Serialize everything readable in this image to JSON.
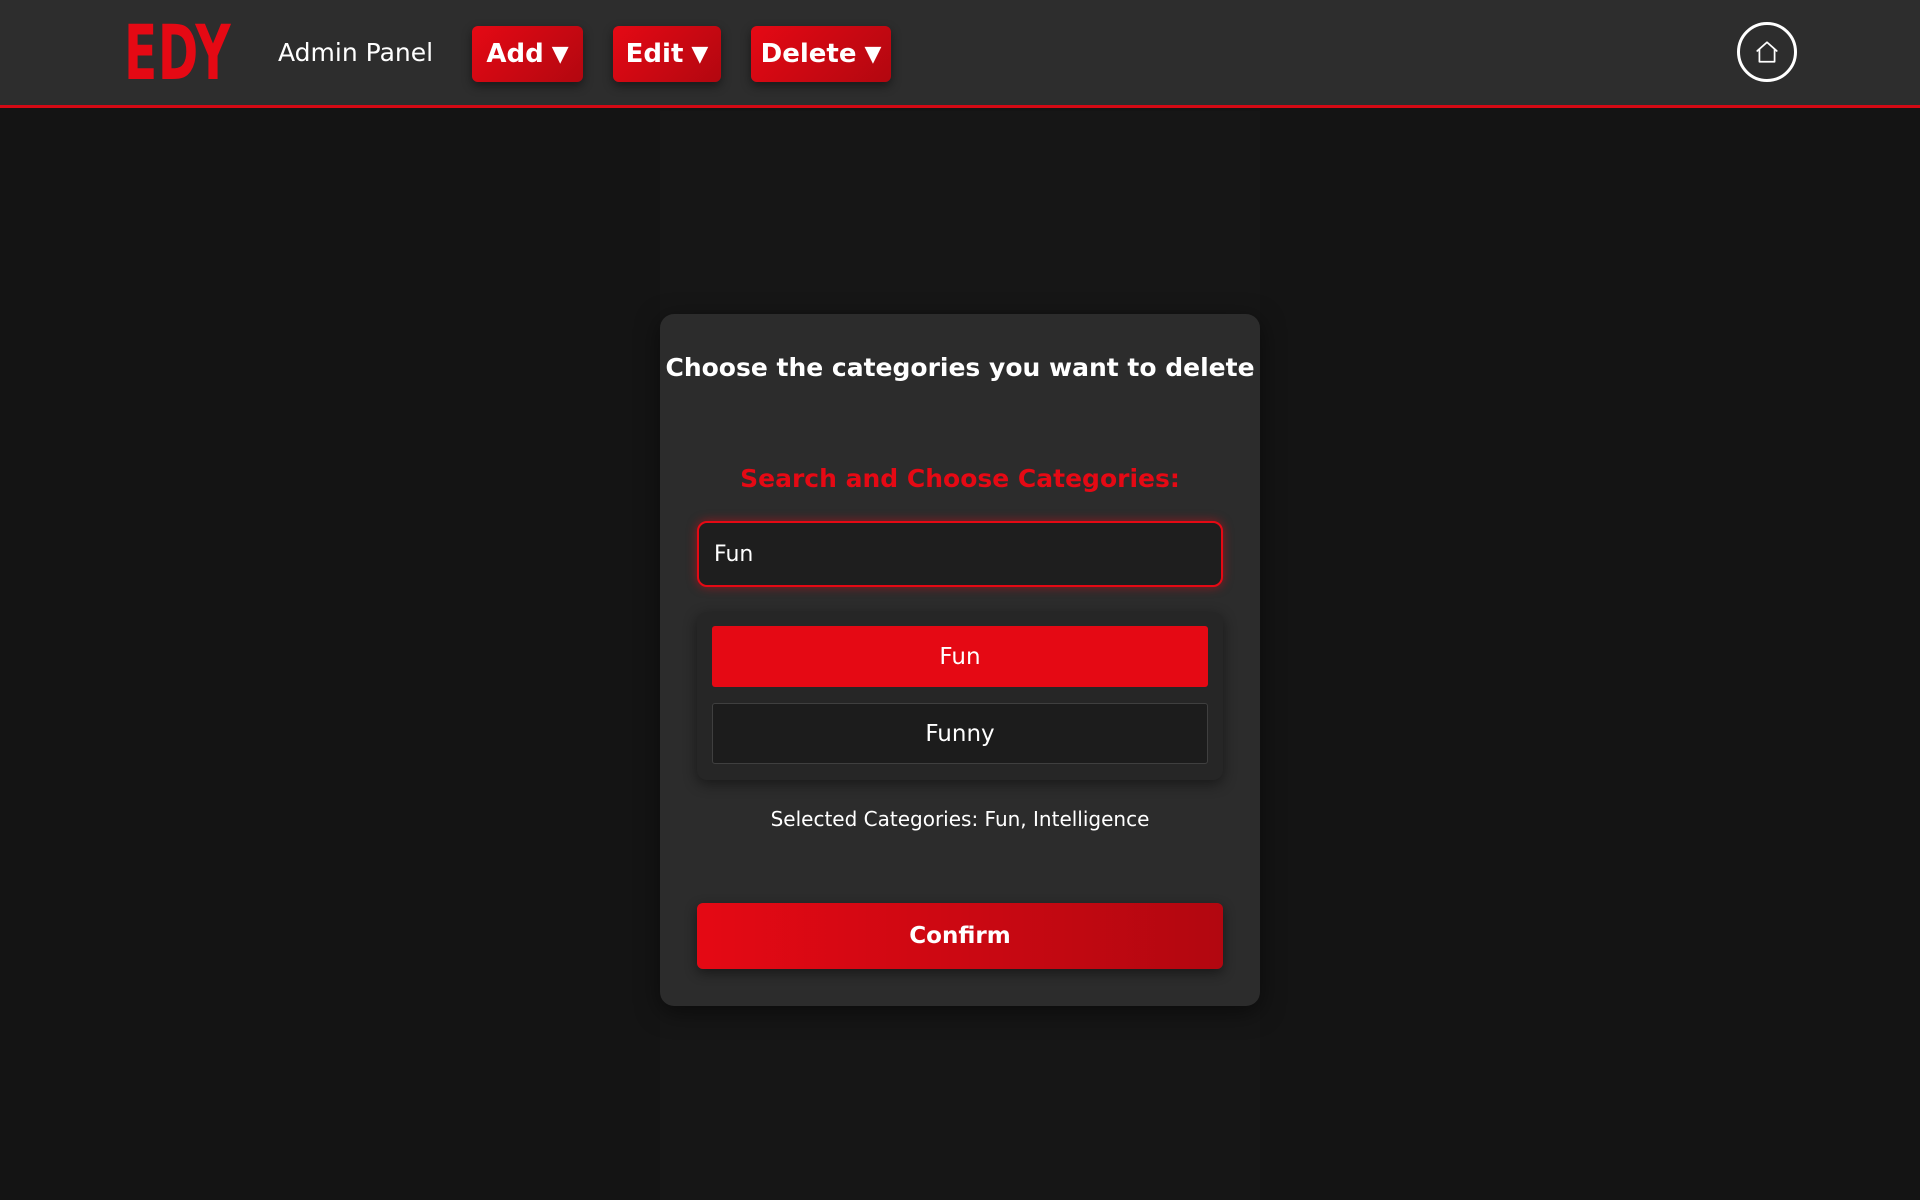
{
  "header": {
    "logo_text": "EDY",
    "title": "Admin Panel",
    "menus": [
      {
        "label": "Add",
        "caret": "▼"
      },
      {
        "label": "Edit",
        "caret": "▼"
      },
      {
        "label": "Delete",
        "caret": "▼"
      }
    ],
    "home_icon": "home-icon"
  },
  "card": {
    "title": "Choose the categories you want to delete",
    "search_label": "Search and Choose Categories:",
    "search_value": "Fun",
    "results": [
      {
        "label": "Fun",
        "selected": true
      },
      {
        "label": "Funny",
        "selected": false
      }
    ],
    "selected_text": "Selected Categories: Fun, Intelligence",
    "confirm_label": "Confirm"
  },
  "colors": {
    "accent": "#e50914",
    "accent_dark": "#b20710",
    "background": "#141414",
    "header_bg": "#2d2d2d",
    "card_bg": "#2c2c2c"
  }
}
